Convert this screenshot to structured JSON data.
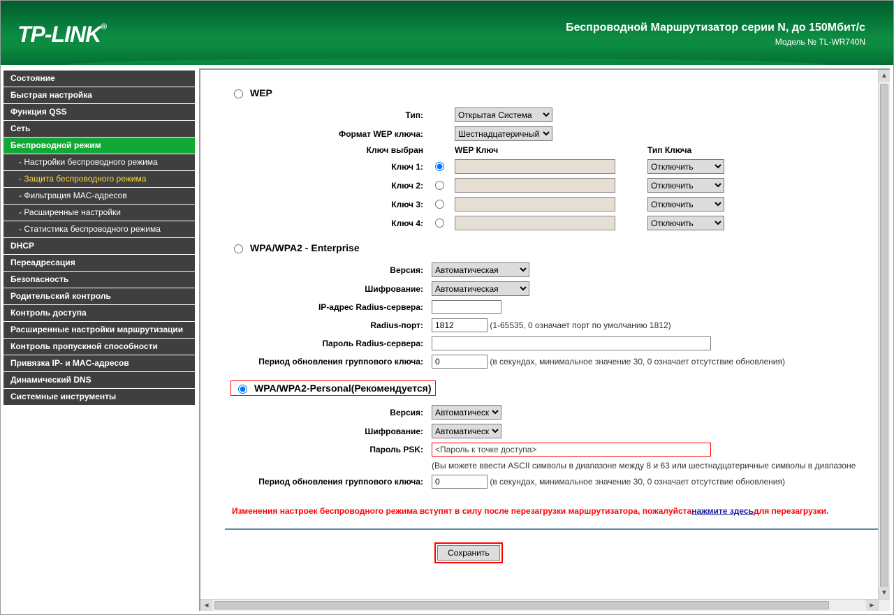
{
  "header": {
    "brand": "TP-LINK",
    "regmark": "®",
    "title": "Беспроводной Маршрутизатор серии N, до 150Мбит/с",
    "model": "Модель № TL-WR740N"
  },
  "sidebar": {
    "items": [
      {
        "id": "status",
        "label": "Состояние"
      },
      {
        "id": "quicksetup",
        "label": "Быстрая настройка"
      },
      {
        "id": "qss",
        "label": "Функция QSS"
      },
      {
        "id": "net",
        "label": "Сеть"
      },
      {
        "id": "wireless",
        "label": "Беспроводной режим",
        "active": true
      },
      {
        "id": "w-settings",
        "label": "- Настройки беспроводного режима",
        "sub": true
      },
      {
        "id": "w-security",
        "label": "- Защита беспроводного режима",
        "sub": true,
        "activeSub": true
      },
      {
        "id": "w-mac",
        "label": "- Фильтрация MAC-адресов",
        "sub": true
      },
      {
        "id": "w-adv",
        "label": "- Расширенные настройки",
        "sub": true
      },
      {
        "id": "w-stat",
        "label": "- Статистика беспроводного режима",
        "sub": true
      },
      {
        "id": "dhcp",
        "label": "DHCP"
      },
      {
        "id": "fwd",
        "label": "Переадресация"
      },
      {
        "id": "sec",
        "label": "Безопасность"
      },
      {
        "id": "parent",
        "label": "Родительский контроль"
      },
      {
        "id": "access",
        "label": "Контроль доступа"
      },
      {
        "id": "route",
        "label": "Расширенные настройки маршрутизации"
      },
      {
        "id": "bw",
        "label": "Контроль пропускной способности"
      },
      {
        "id": "ipmac",
        "label": "Привязка IP- и MAC-адресов"
      },
      {
        "id": "ddns",
        "label": "Динамический DNS"
      },
      {
        "id": "tools",
        "label": "Системные инструменты"
      }
    ]
  },
  "wep": {
    "title": "WEP",
    "labels": {
      "type": "Тип:",
      "format": "Формат WEP ключа:",
      "keysel": "Ключ выбран",
      "wepkey": "WEP Ключ",
      "keytype": "Тип Ключа",
      "key": "Ключ"
    },
    "type_value": "Открытая Система",
    "format_value": "Шестнадцатеричный",
    "keys": [
      {
        "n": "1:",
        "selected": true,
        "type": "Отключить"
      },
      {
        "n": "2:",
        "selected": false,
        "type": "Отключить"
      },
      {
        "n": "3:",
        "selected": false,
        "type": "Отключить"
      },
      {
        "n": "4:",
        "selected": false,
        "type": "Отключить"
      }
    ]
  },
  "ent": {
    "title": "WPA/WPA2 - Enterprise",
    "labels": {
      "ver": "Версия:",
      "enc": "Шифрование:",
      "radiusip": "IP-адрес Radius-сервера:",
      "radiusport": "Radius-порт:",
      "radiuspwd": "Пароль Radius-сервера:",
      "gkup": "Период обновления группового ключа:"
    },
    "ver_value": "Автоматическая",
    "enc_value": "Автоматическая",
    "radius_ip": "",
    "radius_port": "1812",
    "radius_pwd": "",
    "port_hint": "(1-65535, 0 означает порт по умолчанию 1812)",
    "gk_value": "0",
    "gk_hint": "(в секундах, минимальное значение 30, 0 означает отсутствие обновления)"
  },
  "psk": {
    "title": "WPA/WPA2-Personal(Рекомендуется)",
    "labels": {
      "ver": "Версия:",
      "enc": "Шифрование:",
      "pwd": "Пароль PSK:",
      "gkup": "Период обновления группового ключа:"
    },
    "ver_value": "Автоматическая",
    "enc_value": "Автоматическая",
    "pwd_value": "<Пароль к точке доступа>",
    "hint": "(Вы можете ввести ASCII символы в диапазоне между 8 и 63 или шестнадцатеричные символы в диапазоне",
    "gk_value": "0",
    "gk_hint": "(в секундах, минимальное значение 30, 0 означает отсутствие обновления)"
  },
  "notice": {
    "pre": "Изменения настроек беспроводного режима вступят в силу после перезагрузки маршрутизатора, пожалуйста",
    "link": "нажмите здесь",
    "post": "для перезагрузки."
  },
  "save_label": "Сохранить"
}
